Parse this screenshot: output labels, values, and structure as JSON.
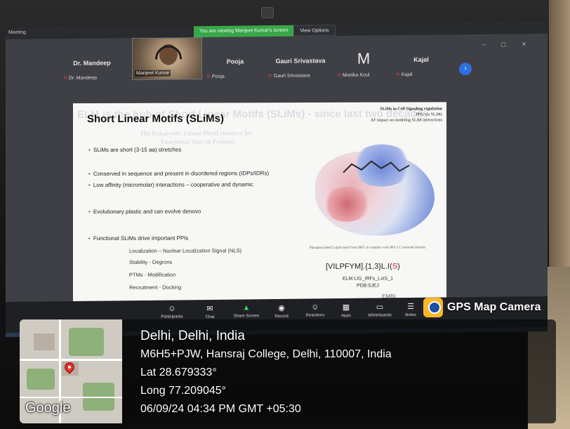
{
  "window": {
    "title": "Meeting",
    "viewing_banner": "You are viewing Manjeet Kumar's screen",
    "view_options": "View Options"
  },
  "participants": [
    {
      "big": "Dr. Mandeep",
      "small": "Dr. Mandeep"
    },
    {
      "video_name": "Manjeet Kumar"
    },
    {
      "big": "Pooja",
      "small": "Pooja"
    },
    {
      "big": "Gauri Srivastava",
      "small": "Gauri Srivastava"
    },
    {
      "letter": "M",
      "small": "Monika Koul"
    },
    {
      "big": "Kajal",
      "small": "Kajal"
    }
  ],
  "slide": {
    "ghost_title": "ELM is the hub of Short Linear Motifs (SLiMs) - since last two decades",
    "title": "Short Linear Motifs (SLiMs)",
    "ghost_sub1": "The Eukaryotic Linear Motif resource for",
    "ghost_sub2": "Functional Sites in Proteins",
    "top_right": [
      "SLiMs in Cell Signaling regulation",
      "PPIs via SLiMs",
      "AF impact on modeling SLiM interactions"
    ],
    "bullets": [
      "SLiMs are short (3-15 aa) stretches",
      "Conserved in sequence and present in disordered regions (IDPs/IDRs)",
      "Low affinity (micromolar) interactions – cooperative and dynamic",
      "Evolutionary plastic and can evolve denovo",
      "Functional SLiMs drive important PPIs"
    ],
    "sub_bullets": [
      "Localization – Nuclear Localization Signal (NLS)",
      "Stability - Degrons",
      "PTMs - Modification",
      "Recruitment - Docking"
    ],
    "caption": "Phosphorylated LxIpS motif from IRF5 in complex with IRF-3 C terminal domain.",
    "motif_prefix": "[VILPFYM].{1,3}L.I(",
    "motif_red": "S",
    "motif_suffix": ")",
    "elm_id": "ELM:LIG_IRFs_LxIS_1",
    "pdb_id": "PDB:5JEJ",
    "embl": "EMBL"
  },
  "toolbar": [
    {
      "icon": "participants-icon",
      "glyph": "☺",
      "label": "Participants"
    },
    {
      "icon": "chat-icon",
      "glyph": "✉",
      "label": "Chat"
    },
    {
      "icon": "share-screen-icon",
      "glyph": "▲",
      "label": "Share Screen",
      "green": true
    },
    {
      "icon": "record-icon",
      "glyph": "◉",
      "label": "Record"
    },
    {
      "icon": "reactions-icon",
      "glyph": "☺",
      "label": "Reactions"
    },
    {
      "icon": "apps-icon",
      "glyph": "▦",
      "label": "Apps"
    },
    {
      "icon": "whiteboards-icon",
      "glyph": "▭",
      "label": "Whiteboards"
    },
    {
      "icon": "notes-icon",
      "glyph": "☰",
      "label": "Notes"
    }
  ],
  "gps": {
    "app_name": "GPS Map Camera",
    "city": "Delhi, Delhi, India",
    "address": "M6H5+PJW, Hansraj College, Delhi, 110007, India",
    "lat": "Lat 28.679333°",
    "long": "Long 77.209045°",
    "datetime": "06/09/24 04:34 PM GMT +05:30",
    "map_brand": "Google"
  }
}
